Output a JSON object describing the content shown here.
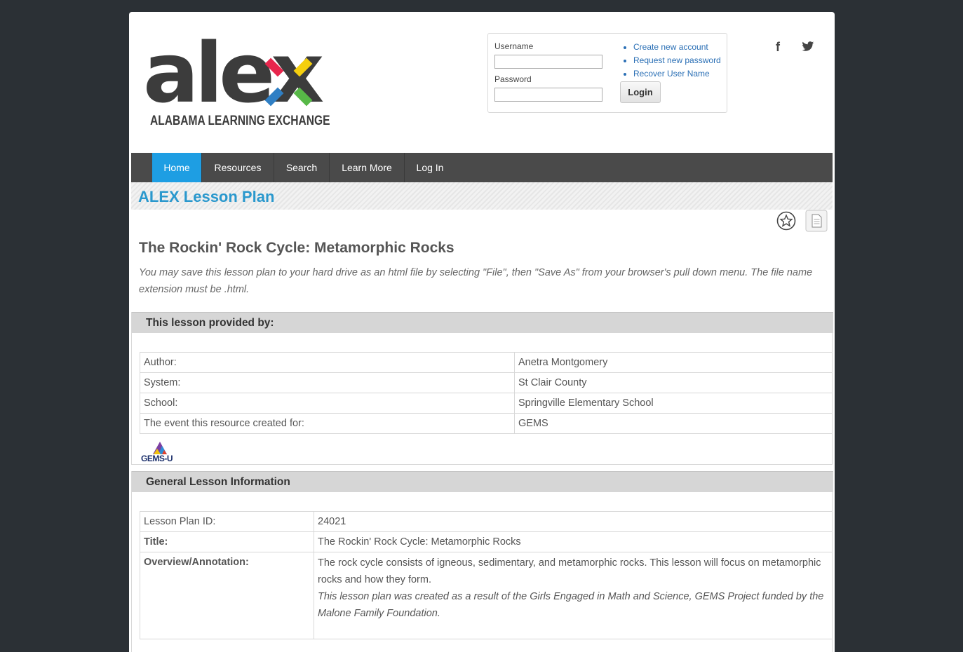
{
  "header": {
    "logo_word": "alex",
    "logo_subtitle": "ALABAMA LEARNING EXCHANGE",
    "login": {
      "username_label": "Username",
      "password_label": "Password",
      "login_button": "Login",
      "links": [
        "Create new account",
        "Request new password",
        "Recover User Name"
      ]
    },
    "social": {
      "facebook": "f",
      "twitter_icon": "twitter-icon"
    }
  },
  "nav": {
    "items": [
      {
        "label": "Home",
        "active": true
      },
      {
        "label": "Resources",
        "active": false
      },
      {
        "label": "Search",
        "active": false
      },
      {
        "label": "Learn More",
        "active": false
      },
      {
        "label": "Log In",
        "active": false
      }
    ]
  },
  "band": {
    "title": "ALEX Lesson Plan"
  },
  "lesson": {
    "title": "The Rockin' Rock Cycle: Metamorphic Rocks",
    "save_note": "You may save this lesson plan to your hard drive as an html file by selecting \"File\", then \"Save As\" from your browser's pull down menu. The file name extension must be .html."
  },
  "provided_by": {
    "heading": "This lesson provided by:",
    "rows": [
      {
        "label": "Author:",
        "value": "Anetra Montgomery"
      },
      {
        "label": "System:",
        "value": "St Clair County"
      },
      {
        "label": "School:",
        "value": "Springville Elementary School"
      },
      {
        "label": "The event this resource created for:",
        "value": "GEMS"
      }
    ],
    "event_logo_text": "GEMS-U"
  },
  "general": {
    "heading": "General Lesson Information",
    "rows": [
      {
        "label": "Lesson Plan ID:",
        "value": "24021"
      },
      {
        "label": "Title:",
        "value": "The Rockin' Rock Cycle: Metamorphic Rocks"
      },
      {
        "label": "Overview/Annotation:",
        "value": "The rock cycle consists of igneous, sedimentary, and metamorphic rocks. This lesson will focus on metamorphic rocks and how they form.",
        "note": "This lesson plan was created as a result of the Girls Engaged in Math and Science, GEMS Project funded by the Malone Family Foundation."
      }
    ]
  },
  "colors": {
    "accent_blue": "#1e9ee3",
    "title_blue": "#2a98cd",
    "nav_bg": "#4a4a4a",
    "background": "#2b3035"
  }
}
